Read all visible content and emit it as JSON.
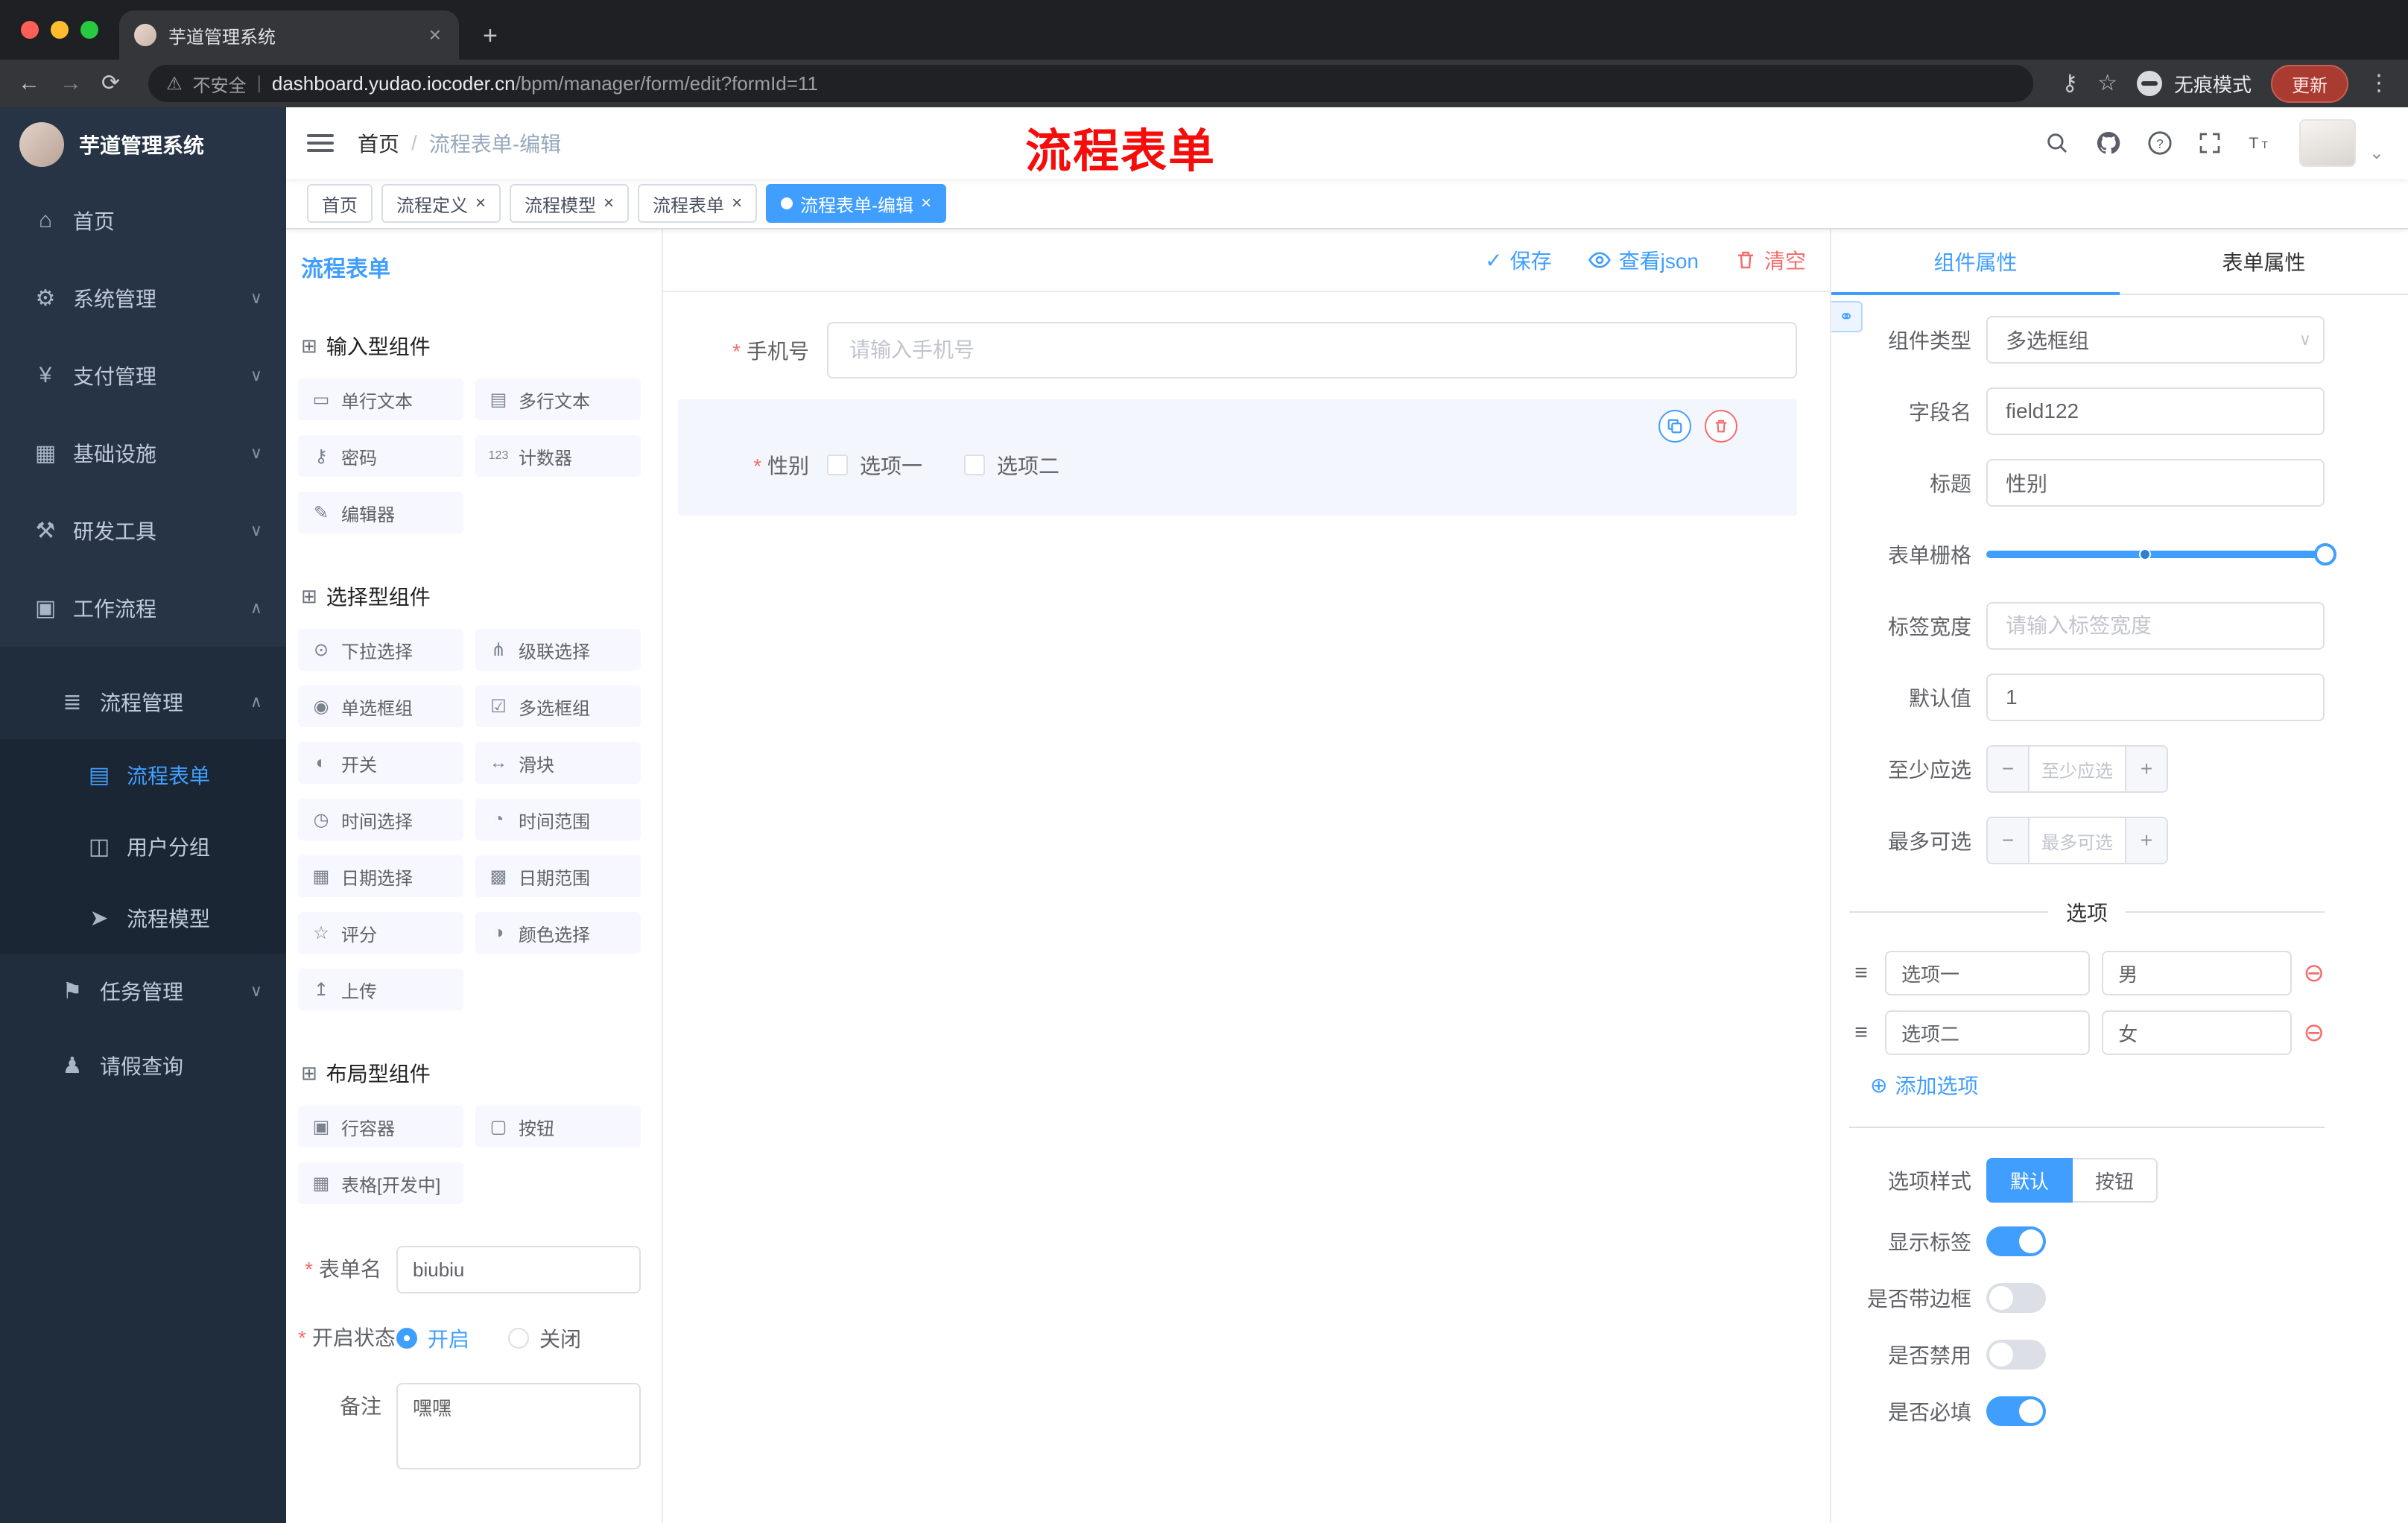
{
  "browser": {
    "tab_title": "芋道管理系统",
    "security_label": "不安全",
    "url_domain": "dashboard.yudao.iocoder.cn",
    "url_path": "/bpm/manager/form/edit?formId=11",
    "incognito_label": "无痕模式",
    "update_label": "更新"
  },
  "sidebar": {
    "logo_title": "芋道管理系统",
    "items": [
      "首页",
      "系统管理",
      "支付管理",
      "基础设施",
      "研发工具",
      "工作流程"
    ],
    "process_mgmt": "流程管理",
    "process_children": [
      "流程表单",
      "用户分组",
      "流程模型"
    ],
    "task_mgmt": "任务管理",
    "leave_query": "请假查询"
  },
  "header": {
    "breadcrumb_home": "首页",
    "breadcrumb_sep": "/",
    "breadcrumb_current": "流程表单-编辑",
    "annotation": "流程表单"
  },
  "tags": {
    "t0": "首页",
    "t1": "流程定义",
    "t2": "流程模型",
    "t3": "流程表单",
    "t4": "流程表单-编辑"
  },
  "builder": {
    "panel_title": "流程表单",
    "save": "保存",
    "view_json": "查看json",
    "clear": "清空",
    "groups": [
      {
        "title": "输入型组件",
        "items": [
          "单行文本",
          "多行文本",
          "密码",
          "计数器",
          "编辑器"
        ]
      },
      {
        "title": "选择型组件",
        "items": [
          "下拉选择",
          "级联选择",
          "单选框组",
          "多选框组",
          "开关",
          "滑块",
          "时间选择",
          "时间范围",
          "日期选择",
          "日期范围",
          "评分",
          "颜色选择",
          "上传"
        ]
      },
      {
        "title": "布局型组件",
        "items": [
          "行容器",
          "按钮",
          "表格[开发中]"
        ]
      }
    ],
    "meta": {
      "form_name_label": "表单名",
      "form_name_value": "biubiu",
      "status_label": "开启状态",
      "status_on": "开启",
      "status_off": "关闭",
      "remark_label": "备注",
      "remark_value": "嘿嘿"
    },
    "canvas": {
      "phone_label": "手机号",
      "phone_placeholder": "请输入手机号",
      "gender_label": "性别",
      "gender_opt1": "选项一",
      "gender_opt2": "选项二"
    }
  },
  "props": {
    "tab_component": "组件属性",
    "tab_form": "表单属性",
    "component_type_label": "组件类型",
    "component_type_value": "多选框组",
    "field_name_label": "字段名",
    "field_name_value": "field122",
    "title_label": "标题",
    "title_value": "性别",
    "grid_label": "表单栅格",
    "label_width_label": "标签宽度",
    "label_width_placeholder": "请输入标签宽度",
    "default_label": "默认值",
    "default_value": "1",
    "min_label": "至少应选",
    "min_placeholder": "至少应选",
    "max_label": "最多可选",
    "max_placeholder": "最多可选",
    "options_title": "选项",
    "options": [
      {
        "label": "选项一",
        "value": "男"
      },
      {
        "label": "选项二",
        "value": "女"
      }
    ],
    "add_option": "添加选项",
    "style_label": "选项样式",
    "style_default": "默认",
    "style_button": "按钮",
    "show_label": "显示标签",
    "border_label": "是否带边框",
    "disabled_label": "是否禁用",
    "required_label": "是否必填"
  },
  "colors": {
    "primary": "#409eff",
    "danger": "#f56c6c",
    "annotation_red": "#f40d0b",
    "sidebar_dark": "#263445"
  },
  "icons": {
    "close": "×",
    "plus": "+",
    "minus": "−",
    "back": "←",
    "forward": "→",
    "reload": "⟳",
    "warning": "⚠",
    "pipe": "|",
    "key": "⚷",
    "star": "☆",
    "dots": "⋮",
    "chevron_down": "∨",
    "chevron_up": "∧",
    "chevron_small": "⌄",
    "home": "⌂",
    "gear": "⚙",
    "yen": "¥",
    "infra": "▦",
    "tools": "⚒",
    "workflow": "▣",
    "process": "≣",
    "doc": "▤",
    "users": "◫",
    "model": "➤",
    "task": "⚑",
    "person": "♟",
    "section": "⊞",
    "check": "✓",
    "drag": "≡",
    "add": "⊕",
    "remove": "⊖",
    "link": "⚭",
    "comp_input": "▭",
    "comp_textarea": "▤",
    "comp_password": "⚷",
    "comp_counter": "123",
    "comp_editor": "✎",
    "comp_select": "⊙",
    "comp_cascader": "⋔",
    "comp_radio": "◉",
    "comp_checkbox": "☑",
    "comp_switch": "◐",
    "comp_slider": "↔",
    "comp_time": "◷",
    "comp_time_range": "◔",
    "comp_date": "▦",
    "comp_date_range": "▩",
    "comp_rate": "☆",
    "comp_color": "◑",
    "comp_upload": "↥",
    "comp_row": "▣",
    "comp_button": "▢",
    "comp_table": "▦"
  }
}
